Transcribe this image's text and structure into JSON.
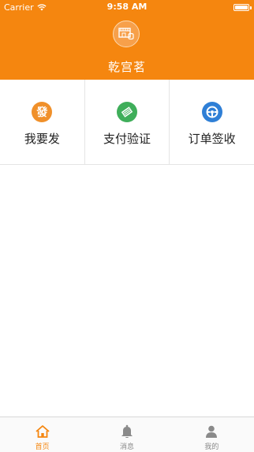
{
  "status_bar": {
    "carrier": "Carrier",
    "time": "9:58 AM"
  },
  "header": {
    "title": "乾宫茗",
    "accent_color": "#f5860f"
  },
  "actions": [
    {
      "label": "我要发",
      "icon": "fa-character-icon",
      "color": "#f0902a"
    },
    {
      "label": "支付验证",
      "icon": "card-icon",
      "color": "#3fae5a"
    },
    {
      "label": "订单签收",
      "icon": "wheel-icon",
      "color": "#2f7fd6"
    }
  ],
  "tabbar": {
    "items": [
      {
        "label": "首页",
        "icon": "home-icon",
        "active": true
      },
      {
        "label": "消息",
        "icon": "bell-icon",
        "active": false
      },
      {
        "label": "我的",
        "icon": "person-icon",
        "active": false
      }
    ]
  }
}
